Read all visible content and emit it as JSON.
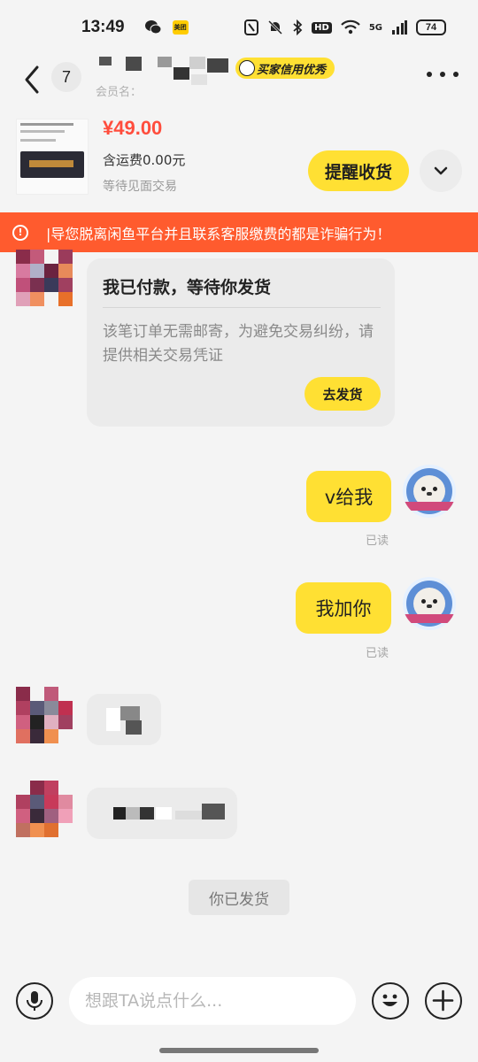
{
  "status_bar": {
    "time": "13:49",
    "battery": "74",
    "network": "5G",
    "wifi_badge": "HD",
    "meituan_label": "美团"
  },
  "header": {
    "unread_count": "7",
    "contact_name": "",
    "credit_badge": "买家信用优秀",
    "member_label": "会员名："
  },
  "product": {
    "price": "¥49.00",
    "shipping": "含运费0.00元",
    "trade_mode": "等待见面交易",
    "remind_button": "提醒收货"
  },
  "warning": {
    "text": "|导您脱离闲鱼平台并且联系客服缴费的都是诈骗行为！"
  },
  "order_card": {
    "title": "我已付款，等待你发货",
    "description": "该笔订单无需邮寄，为避免交易纠纷，请提供相关交易凭证",
    "ship_button": "去发货"
  },
  "messages": [
    {
      "from": "me",
      "text": "v给我",
      "status": "已读"
    },
    {
      "from": "me",
      "text": "我加你",
      "status": "已读"
    }
  ],
  "system_message": "你已发货",
  "input_bar": {
    "placeholder": "想跟TA说点什么..."
  },
  "colors": {
    "accent_yellow": "#ffe033",
    "warning_orange": "#ff5b2e",
    "price_red": "#ff4d3d"
  }
}
